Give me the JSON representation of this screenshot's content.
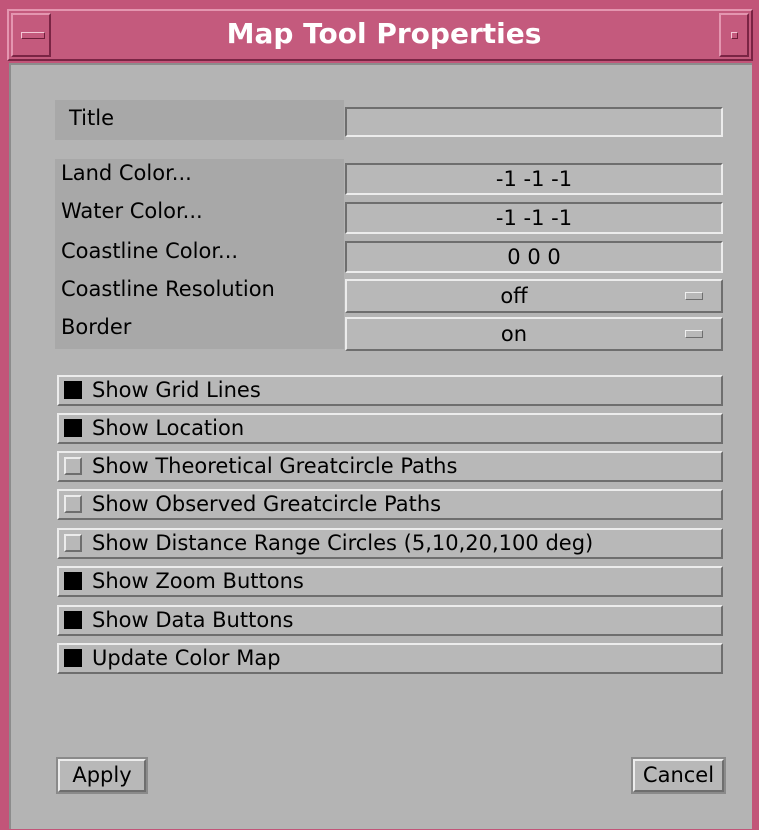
{
  "window": {
    "title": "Map Tool Properties"
  },
  "fields": {
    "title_label": "Title",
    "title_value": "",
    "land_color_label": "Land Color...",
    "land_color_value": "-1 -1 -1",
    "water_color_label": "Water Color...",
    "water_color_value": "-1 -1 -1",
    "coastline_color_label": "Coastline Color...",
    "coastline_color_value": "0 0 0",
    "coastline_resolution_label": "Coastline Resolution",
    "coastline_resolution_value": "off",
    "border_label": "Border",
    "border_value": "on"
  },
  "toggles": [
    {
      "label": "Show Grid Lines",
      "checked": true
    },
    {
      "label": "Show Location",
      "checked": true
    },
    {
      "label": "Show Theoretical Greatcircle Paths",
      "checked": false
    },
    {
      "label": "Show Observed Greatcircle Paths",
      "checked": false
    },
    {
      "label": "Show Distance Range Circles (5,10,20,100 deg)",
      "checked": false
    },
    {
      "label": "Show Zoom Buttons",
      "checked": true
    },
    {
      "label": "Show Data Buttons",
      "checked": true
    },
    {
      "label": "Update Color Map",
      "checked": true
    }
  ],
  "buttons": {
    "apply": "Apply",
    "cancel": "Cancel"
  },
  "colors": {
    "titlebar": "#c45a7d",
    "panel": "#b4b4b4",
    "checked": "#000000"
  }
}
